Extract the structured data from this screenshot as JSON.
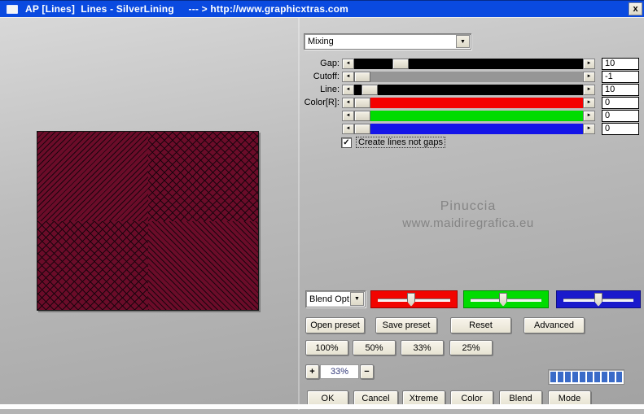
{
  "colors": {
    "titlebar": "#0a4ae0",
    "preview_base": "#6b0c29",
    "preview_line": "#1c040e",
    "progress_segment": "#3a6bc8"
  },
  "titlebar": {
    "title": "AP [Lines]  Lines - SilverLining     --- > http://www.graphicxtras.com",
    "close": "x"
  },
  "icons": {
    "left_arrow": "◄",
    "right_arrow": "►",
    "dropdown": "▼",
    "check": "✓",
    "plus": "+",
    "minus": "−"
  },
  "preset_dropdown": {
    "value": "Mixing"
  },
  "sliders": {
    "rows": [
      {
        "label": "Gap:",
        "value": "10",
        "track": "#000000",
        "thumb": 0.18
      },
      {
        "label": "Cutoff:",
        "value": "-1",
        "track": "#969696",
        "thumb": 0.0
      },
      {
        "label": "Line:",
        "value": "10",
        "track": "#000000",
        "thumb": 0.036
      },
      {
        "label": "Color[R]:",
        "value": "0",
        "track": "#f40000",
        "thumb": 0.0
      },
      {
        "label": "",
        "value": "0",
        "track": "#00dc00",
        "thumb": 0.0
      },
      {
        "label": "",
        "value": "0",
        "track": "#1414e8",
        "thumb": 0.0
      }
    ]
  },
  "checkbox": {
    "label": "Create lines not gaps",
    "checked": true
  },
  "watermark": {
    "line1": "Pinuccia",
    "line2": "www.maidiregrafica.eu"
  },
  "blend_dropdown": {
    "value": "Blend Options"
  },
  "channel_sliders": [
    {
      "name": "red",
      "color": "#f20400",
      "thumb": 0.46
    },
    {
      "name": "green",
      "color": "#00dc00",
      "thumb": 0.46
    },
    {
      "name": "blue",
      "color": "#1a1acc",
      "thumb": 0.5
    }
  ],
  "preset_buttons": {
    "open": "Open preset",
    "save": "Save preset",
    "reset": "Reset",
    "advanced": "Advanced"
  },
  "zoom_buttons": [
    "100%",
    "50%",
    "33%",
    "25%"
  ],
  "zoom_stepper": {
    "value": "33%"
  },
  "progress": {
    "segments": 10
  },
  "action_buttons": [
    "OK",
    "Cancel",
    "Xtreme",
    "Color",
    "Blend",
    "Mode"
  ]
}
